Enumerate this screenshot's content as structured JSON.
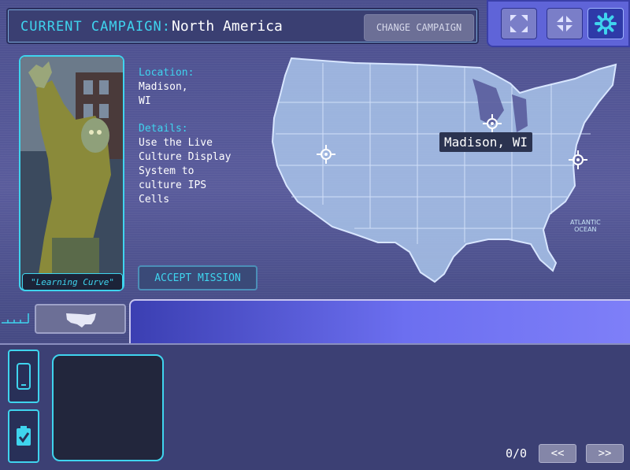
{
  "header": {
    "campaign_label": "CURRENT CAMPAIGN:",
    "campaign_name": "North America",
    "change_campaign": "CHANGE CAMPAIGN"
  },
  "controls": {
    "expand_icon": "expand-icon",
    "collapse_icon": "collapse-icon",
    "settings_icon": "gear-icon"
  },
  "mission": {
    "card_title": "\"Learning Curve\"",
    "location_label": "Location:",
    "location_value": "Madison,\nWI",
    "details_label": "Details:",
    "details_value": "Use the Live\nCulture Display\nSystem to\nculture IPS\nCells",
    "accept_button": "ACCEPT MISSION"
  },
  "map": {
    "tooltip": "Madison, WI",
    "ocean_label_line1": "ATLANTIC",
    "ocean_label_line2": "OCEAN"
  },
  "bottom": {
    "counter": "0/0",
    "prev": "<<",
    "next": ">>"
  },
  "colors": {
    "accent": "#3fd4ee",
    "strip": "#6c6ff0"
  }
}
